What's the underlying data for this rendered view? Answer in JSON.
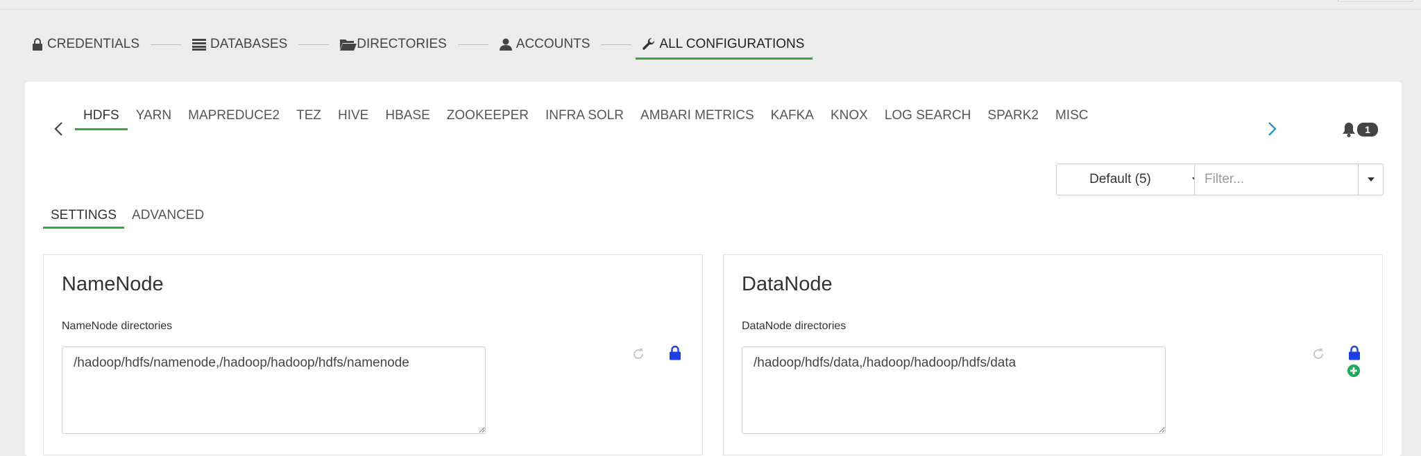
{
  "wizard": {
    "steps": [
      {
        "label": "CREDENTIALS",
        "icon": "lock-icon"
      },
      {
        "label": "DATABASES",
        "icon": "database-icon"
      },
      {
        "label": "DIRECTORIES",
        "icon": "folder-open-icon"
      },
      {
        "label": "ACCOUNTS",
        "icon": "user-icon"
      },
      {
        "label": "ALL CONFIGURATIONS",
        "icon": "wrench-icon",
        "active": true
      }
    ]
  },
  "services": {
    "tabs": [
      "HDFS",
      "YARN",
      "MAPREDUCE2",
      "TEZ",
      "HIVE",
      "HBASE",
      "ZOOKEEPER",
      "INFRA SOLR",
      "AMBARI METRICS",
      "KAFKA",
      "KNOX",
      "LOG SEARCH",
      "SPARK2",
      "MISC"
    ],
    "active": "HDFS",
    "notifications_count": "1"
  },
  "toolbar": {
    "config_group": "Default (5)",
    "filter_placeholder": "Filter..."
  },
  "sub_tabs": [
    "SETTINGS",
    "ADVANCED"
  ],
  "namenode": {
    "title": "NameNode",
    "label": "NameNode directories",
    "value": "/hadoop/hdfs/namenode,/hadoop/hadoop/hdfs/namenode"
  },
  "datanode": {
    "title": "DataNode",
    "label": "DataNode directories",
    "value": "/hadoop/hdfs/data,/hadoop/hadoop/hdfs/data"
  },
  "colors": {
    "accent_green": "#3aa537",
    "lock_blue": "#1d3fe0",
    "nav_blue": "#1a8bc3",
    "add_green": "#1ea85a"
  }
}
